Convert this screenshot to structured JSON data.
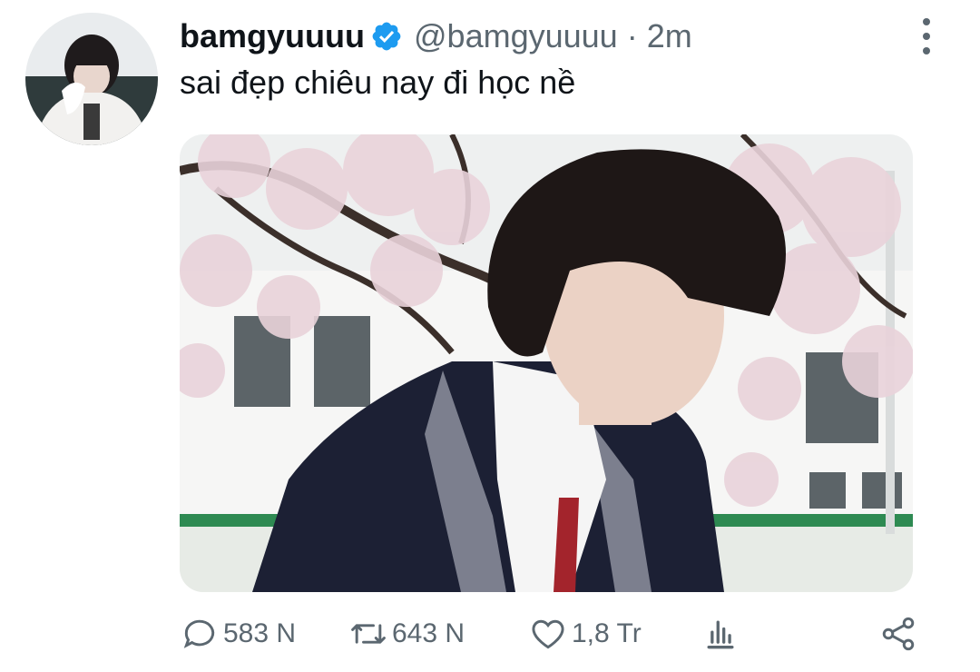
{
  "tweet": {
    "display_name": "bamgyuuuu",
    "handle": "@bamgyuuuu",
    "separator": "·",
    "time": "2m",
    "verified": true,
    "text": "sai đẹp chiêu nay đi học nề",
    "media": {
      "type": "photo"
    }
  },
  "actions": {
    "reply_count": "583 N",
    "retweet_count": "643 N",
    "like_count": "1,8 Tr"
  },
  "icons": {
    "verified": "verified-badge-icon",
    "more": "more-vertical-icon",
    "reply": "reply-icon",
    "retweet": "retweet-icon",
    "like": "heart-icon",
    "stats": "analytics-icon",
    "share": "share-icon"
  },
  "colors": {
    "text_primary": "#0f1419",
    "text_secondary": "#5b6770",
    "verified_blue": "#1d9bf0"
  }
}
